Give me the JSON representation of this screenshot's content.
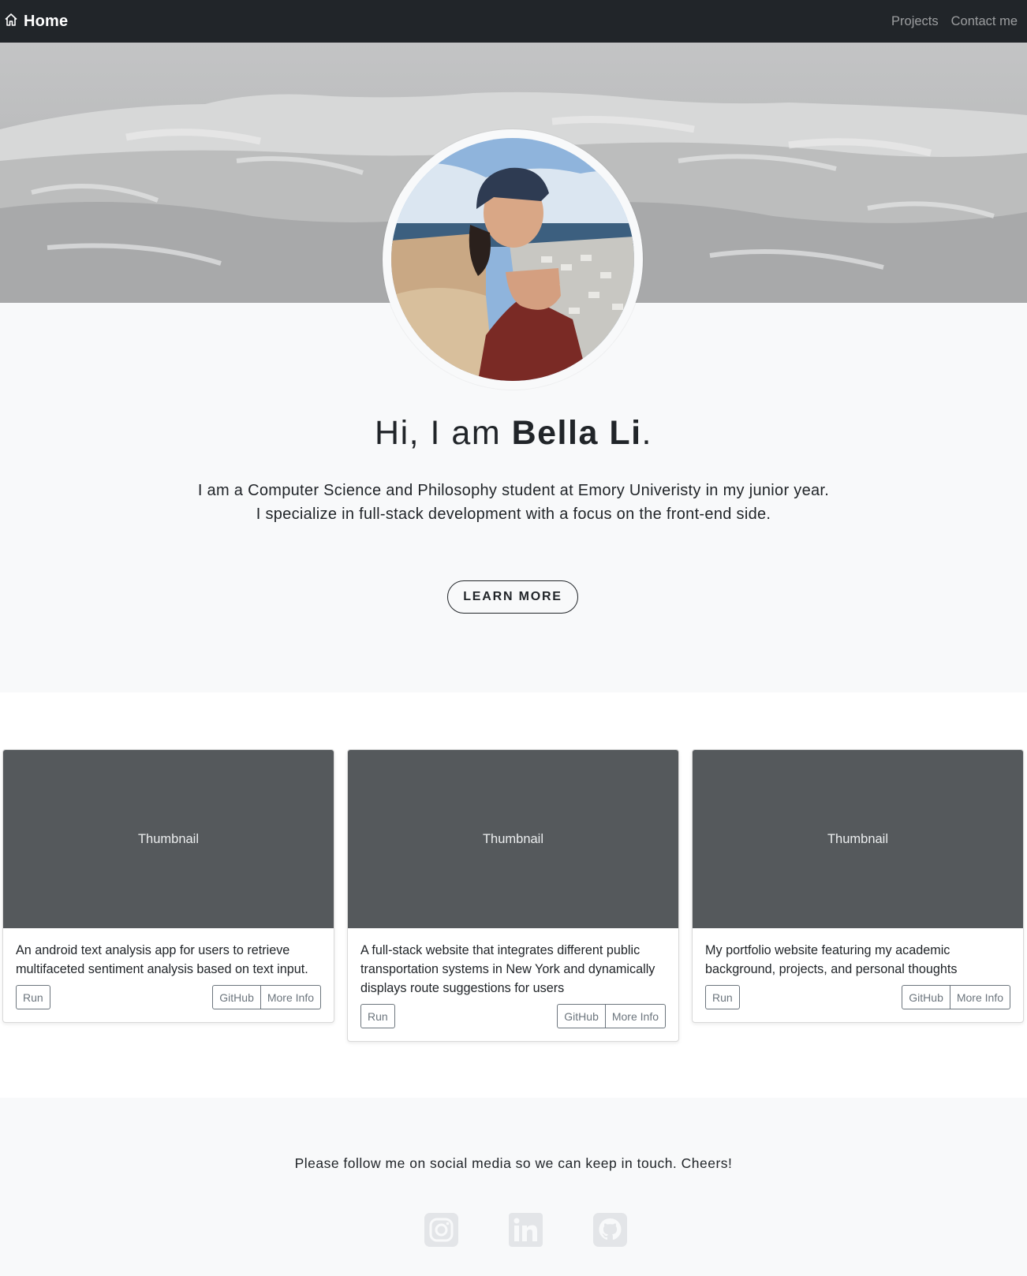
{
  "nav": {
    "brand_label": "Home",
    "brand_icon": "house-icon",
    "links": [
      "Projects",
      "Contact me"
    ]
  },
  "hero": {
    "greeting_prefix": "Hi, I am ",
    "name": "Bella Li",
    "greeting_suffix": ".",
    "intro_line1": "I am a Computer Science and Philosophy student at Emory Univeristy in my junior year.",
    "intro_line2": "I specialize in full-stack development with a focus on the front-end side.",
    "cta_label": "LEARN MORE"
  },
  "projects": [
    {
      "thumbnail_label": "Thumbnail",
      "description": "An android text analysis app for users to retrieve multifaceted sentiment analysis based on text input.",
      "run_label": "Run",
      "github_label": "GitHub",
      "info_label": "More Info"
    },
    {
      "thumbnail_label": "Thumbnail",
      "description": "A full-stack website that integrates different public transportation systems in New York and dynamically displays route suggestions for users",
      "run_label": "Run",
      "github_label": "GitHub",
      "info_label": "More Info"
    },
    {
      "thumbnail_label": "Thumbnail",
      "description": "My portfolio website featuring my academic background, projects, and personal thoughts",
      "run_label": "Run",
      "github_label": "GitHub",
      "info_label": "More Info"
    }
  ],
  "footer": {
    "follow_text": "Please follow me on social media so we can keep in touch. Cheers!",
    "social_icons": [
      "instagram-icon",
      "linkedin-icon",
      "github-icon"
    ]
  },
  "colors": {
    "navbar_bg": "#212529",
    "thumbnail_bg": "#55595c",
    "section_bg": "#f8f9fa",
    "social_icon": "#e3e5e8"
  }
}
